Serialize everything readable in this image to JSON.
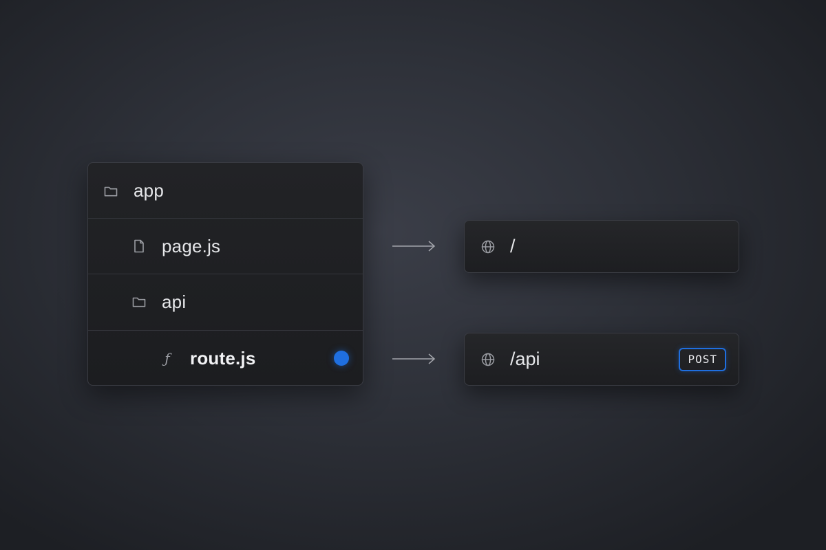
{
  "file_tree": {
    "items": [
      {
        "label": "app",
        "icon": "folder-icon",
        "depth": 0
      },
      {
        "label": "page.js",
        "icon": "file-icon",
        "depth": 1
      },
      {
        "label": "api",
        "icon": "folder-icon",
        "depth": 1
      },
      {
        "label": "route.js",
        "icon": "function-icon",
        "icon_glyph": "ƒ",
        "depth": 2,
        "active": true
      }
    ]
  },
  "routes": [
    {
      "path": "/",
      "icon": "globe-icon",
      "method": ""
    },
    {
      "path": "/api",
      "icon": "globe-icon",
      "method": "POST"
    }
  ],
  "colors": {
    "accent": "#1f6fe0",
    "panel": "#1f2023",
    "text": "#e6e7ea",
    "icon": "#9b9da3"
  }
}
